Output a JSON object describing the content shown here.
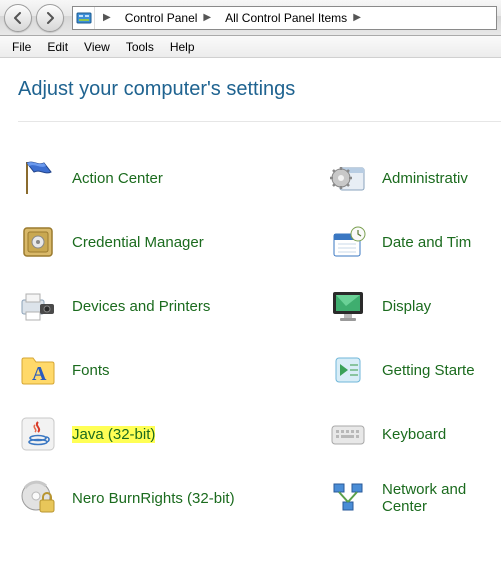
{
  "nav": {
    "breadcrumb": [
      "Control Panel",
      "All Control Panel Items"
    ]
  },
  "menu": [
    "File",
    "Edit",
    "View",
    "Tools",
    "Help"
  ],
  "heading": "Adjust your computer's settings",
  "items_left": [
    {
      "label": "Action Center"
    },
    {
      "label": "Credential Manager"
    },
    {
      "label": "Devices and Printers"
    },
    {
      "label": "Fonts"
    },
    {
      "label": "Java (32-bit)",
      "highlight": true
    },
    {
      "label": "Nero BurnRights (32-bit)"
    }
  ],
  "items_right": [
    {
      "label": "Administrativ"
    },
    {
      "label": "Date and Tim"
    },
    {
      "label": "Display"
    },
    {
      "label": "Getting Starte"
    },
    {
      "label": "Keyboard"
    },
    {
      "label": "Network and \nCenter"
    }
  ]
}
